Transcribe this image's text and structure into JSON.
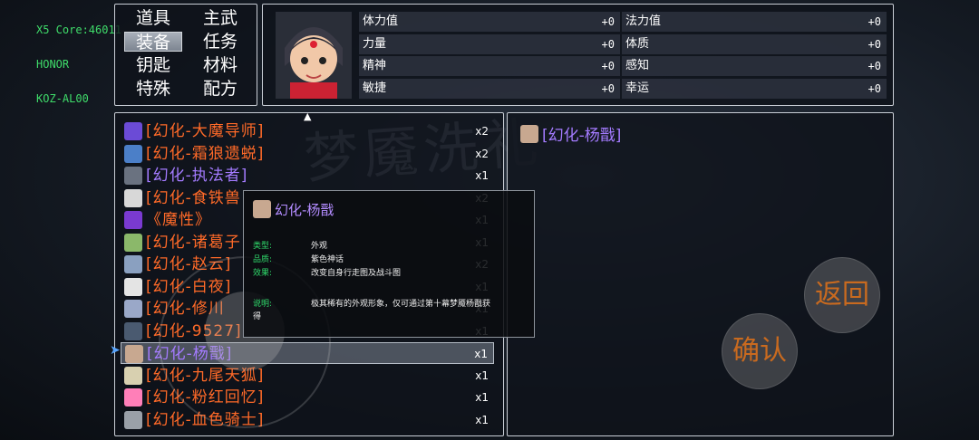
{
  "device": {
    "core": "X5 Core:46011",
    "brand": "HONOR",
    "model": "KOZ-AL00"
  },
  "categories": [
    {
      "label": "道具",
      "selected": false
    },
    {
      "label": "主武",
      "selected": false
    },
    {
      "label": "装备",
      "selected": true
    },
    {
      "label": "任务",
      "selected": false
    },
    {
      "label": "钥匙",
      "selected": false
    },
    {
      "label": "材料",
      "selected": false
    },
    {
      "label": "特殊",
      "selected": false
    },
    {
      "label": "配方",
      "selected": false
    }
  ],
  "stats": [
    {
      "label": "体力值",
      "value": "+0"
    },
    {
      "label": "法力值",
      "value": "+0"
    },
    {
      "label": "力量",
      "value": "+0"
    },
    {
      "label": "体质",
      "value": "+0"
    },
    {
      "label": "精神",
      "value": "+0"
    },
    {
      "label": "感知",
      "value": "+0"
    },
    {
      "label": "敏捷",
      "value": "+0"
    },
    {
      "label": "幸运",
      "value": "+0"
    }
  ],
  "items": [
    {
      "name": "[幻化-大魔导师]",
      "qty": "x2",
      "color": "#ff6a28",
      "icon_color": "#6b4bd6"
    },
    {
      "name": "[幻化-霜狼遗蜕]",
      "qty": "x2",
      "color": "#ff6a28",
      "icon_color": "#4b7fc8"
    },
    {
      "name": "[幻化-执法者]",
      "qty": "x1",
      "color": "#a47bff",
      "icon_color": "#6a7280"
    },
    {
      "name": "[幻化-食铁兽",
      "qty": "x2",
      "color": "#ff6a28",
      "icon_color": "#d8d8d8"
    },
    {
      "name": "《魔性》",
      "qty": "x1",
      "color": "#ff6a28",
      "icon_color": "#7a3ad0"
    },
    {
      "name": "[幻化-诸葛子",
      "qty": "x1",
      "color": "#ff6a28",
      "icon_color": "#8bb86a"
    },
    {
      "name": "[幻化-赵云]",
      "qty": "x2",
      "color": "#ff6a28",
      "icon_color": "#8aa0c0"
    },
    {
      "name": "[幻化-白夜]",
      "qty": "x1",
      "color": "#ff6a28",
      "icon_color": "#e4e4e4"
    },
    {
      "name": "[幻化-修川",
      "qty": "x1",
      "color": "#ff6a28",
      "icon_color": "#9aa8c8"
    },
    {
      "name": "[幻化-9527]",
      "qty": "x1",
      "color": "#ff6a28",
      "icon_color": "#4a5a70"
    },
    {
      "name": "[幻化-杨戬]",
      "qty": "x1",
      "color": "#a47bff",
      "icon_color": "#c8a890",
      "selected": true
    },
    {
      "name": "[幻化-九尾天狐]",
      "qty": "x1",
      "color": "#ff6a28",
      "icon_color": "#d8d0b0"
    },
    {
      "name": "[幻化-粉红回忆]",
      "qty": "x1",
      "color": "#ff6a28",
      "icon_color": "#ff7fb8"
    },
    {
      "name": "[幻化-血色骑士]",
      "qty": "x1",
      "color": "#ff6a28",
      "icon_color": "#9aa0a8"
    }
  ],
  "equipped": {
    "name": "[幻化-杨戬]"
  },
  "tooltip": {
    "title": "幻化-杨戬",
    "type_label": "类型:",
    "type_value": "外观",
    "quality_label": "品质:",
    "quality_value": "紫色神话",
    "effect_label": "效果:",
    "effect_value": "改变自身行走图及战斗图",
    "desc_label": "说明:",
    "desc_value": "极其稀有的外观形象，仅可通过第十幕梦魇杨戬获",
    "desc_tail": "得"
  },
  "watermark": "梦魇洗礼",
  "buttons": {
    "back": "返回",
    "confirm": "确认"
  }
}
